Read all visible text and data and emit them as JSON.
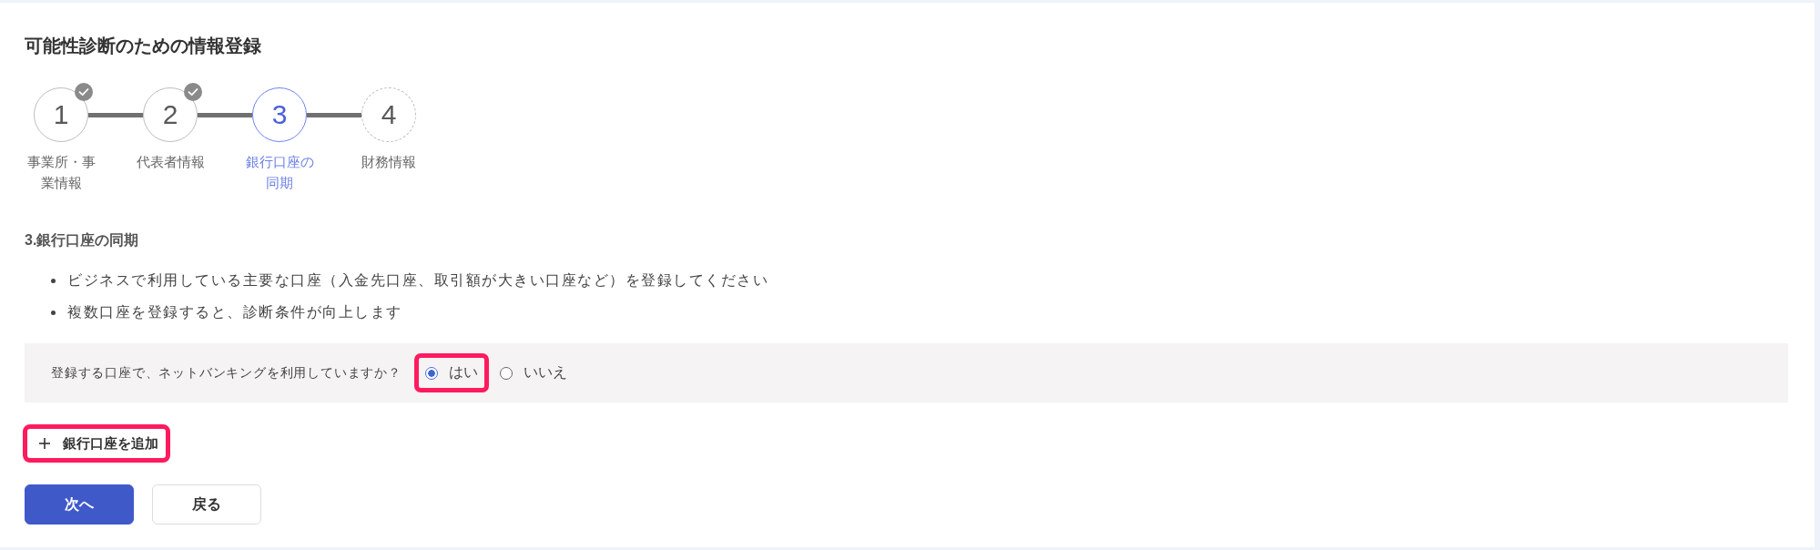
{
  "page": {
    "title": "可能性診断のための情報登録"
  },
  "stepper": {
    "steps": [
      {
        "number": "1",
        "label": "事業所・事業情報",
        "completed": true,
        "current": false
      },
      {
        "number": "2",
        "label": "代表者情報",
        "completed": true,
        "current": false
      },
      {
        "number": "3",
        "label": "銀行口座の同期",
        "completed": false,
        "current": true
      },
      {
        "number": "4",
        "label": "財務情報",
        "completed": false,
        "current": false
      }
    ]
  },
  "section": {
    "title": "3.銀行口座の同期",
    "bullets": [
      "ビジネスで利用している主要な口座（入金先口座、取引額が大きい口座など）を登録してください",
      "複数口座を登録すると、診断条件が向上します"
    ]
  },
  "question": {
    "text": "登録する口座で、ネットバンキングを利用していますか？",
    "options": [
      {
        "label": "はい",
        "selected": true,
        "highlighted": true
      },
      {
        "label": "いいえ",
        "selected": false,
        "highlighted": false
      }
    ]
  },
  "add_account_button": {
    "label": "銀行口座を追加",
    "highlighted": true
  },
  "buttons": [
    {
      "label": "次へ",
      "kind": "primary"
    },
    {
      "label": "戻る",
      "kind": "secondary"
    }
  ]
}
